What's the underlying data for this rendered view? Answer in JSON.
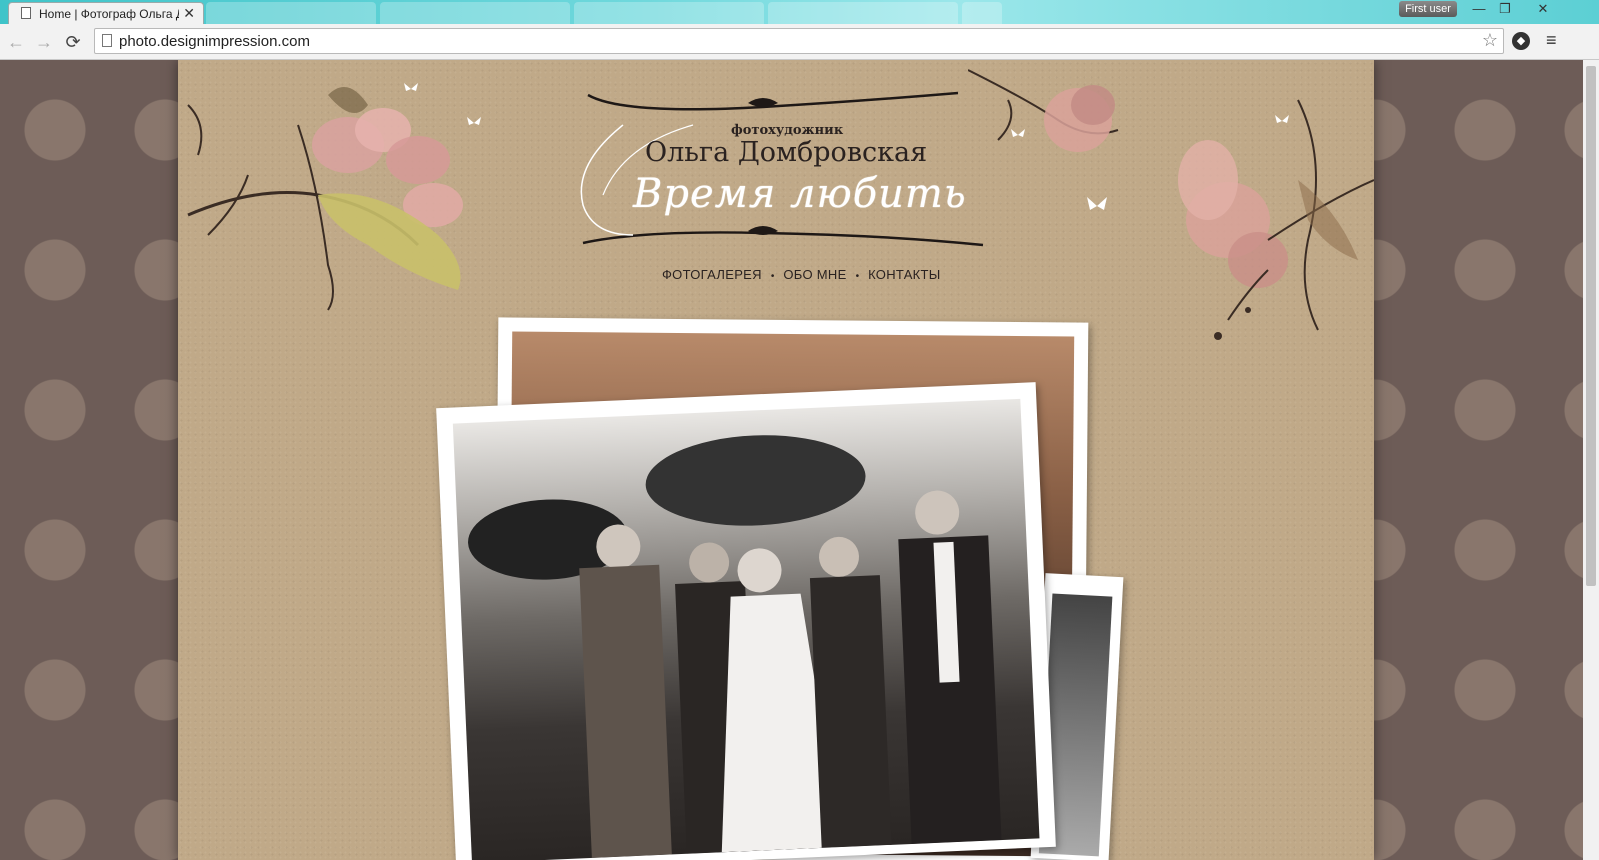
{
  "browser": {
    "active_tab_title": "Home | Фотограф Ольга Д",
    "tab_close": "✕",
    "user_button": "First user",
    "url": "photo.designimpression.com",
    "back_icon": "←",
    "forward_icon": "→",
    "reload_icon": "⟳",
    "bookmark_star": "☆",
    "menu_icon": "≡",
    "minimize": "—",
    "restore": "❐",
    "close": "✕"
  },
  "site": {
    "logo": {
      "subtitle": "фотохудожник",
      "name": "Ольга Домбровская",
      "script": "Время любить"
    },
    "nav": [
      {
        "label": "ФОТОГАЛЕРЕЯ"
      },
      {
        "label": "ОБО МНЕ"
      },
      {
        "label": "КОНТАКТЫ"
      }
    ],
    "nav_separator": "•"
  },
  "colors": {
    "page_background": "#6d5c57",
    "content_background": "#c0a988",
    "ink": "#2a2220"
  }
}
